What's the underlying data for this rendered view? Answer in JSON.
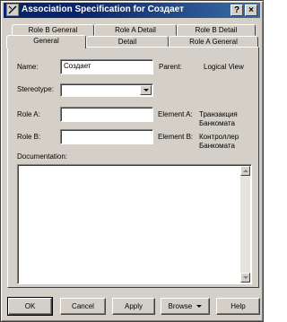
{
  "window": {
    "title": "Association Specification for Создает",
    "help_glyph": "?",
    "close_glyph": "×",
    "icon": "association-icon"
  },
  "tabs": {
    "row1": [
      "Role B General",
      "Role A Detail",
      "Role B Detail"
    ],
    "row2": [
      "General",
      "Detail",
      "Role A General"
    ],
    "active": "General"
  },
  "form": {
    "name_label": "Name:",
    "name_value": "Создает",
    "parent_label": "Parent:",
    "parent_value": "Logical View",
    "stereotype_label": "Stereotype:",
    "stereotype_value": "",
    "role_a_label": "Role A:",
    "role_a_value": "",
    "element_a_label": "Element A:",
    "element_a_value_line1": "Транзакция",
    "element_a_value_line2": "Банкомата",
    "role_b_label": "Role B:",
    "role_b_value": "",
    "element_b_label": "Element B:",
    "element_b_value_line1": "Контроллер",
    "element_b_value_line2": "Банкомата",
    "documentation_label": "Documentation:",
    "documentation_value": ""
  },
  "buttons": {
    "ok": "OK",
    "cancel": "Cancel",
    "apply": "Apply",
    "browse": "Browse",
    "help": "Help"
  }
}
